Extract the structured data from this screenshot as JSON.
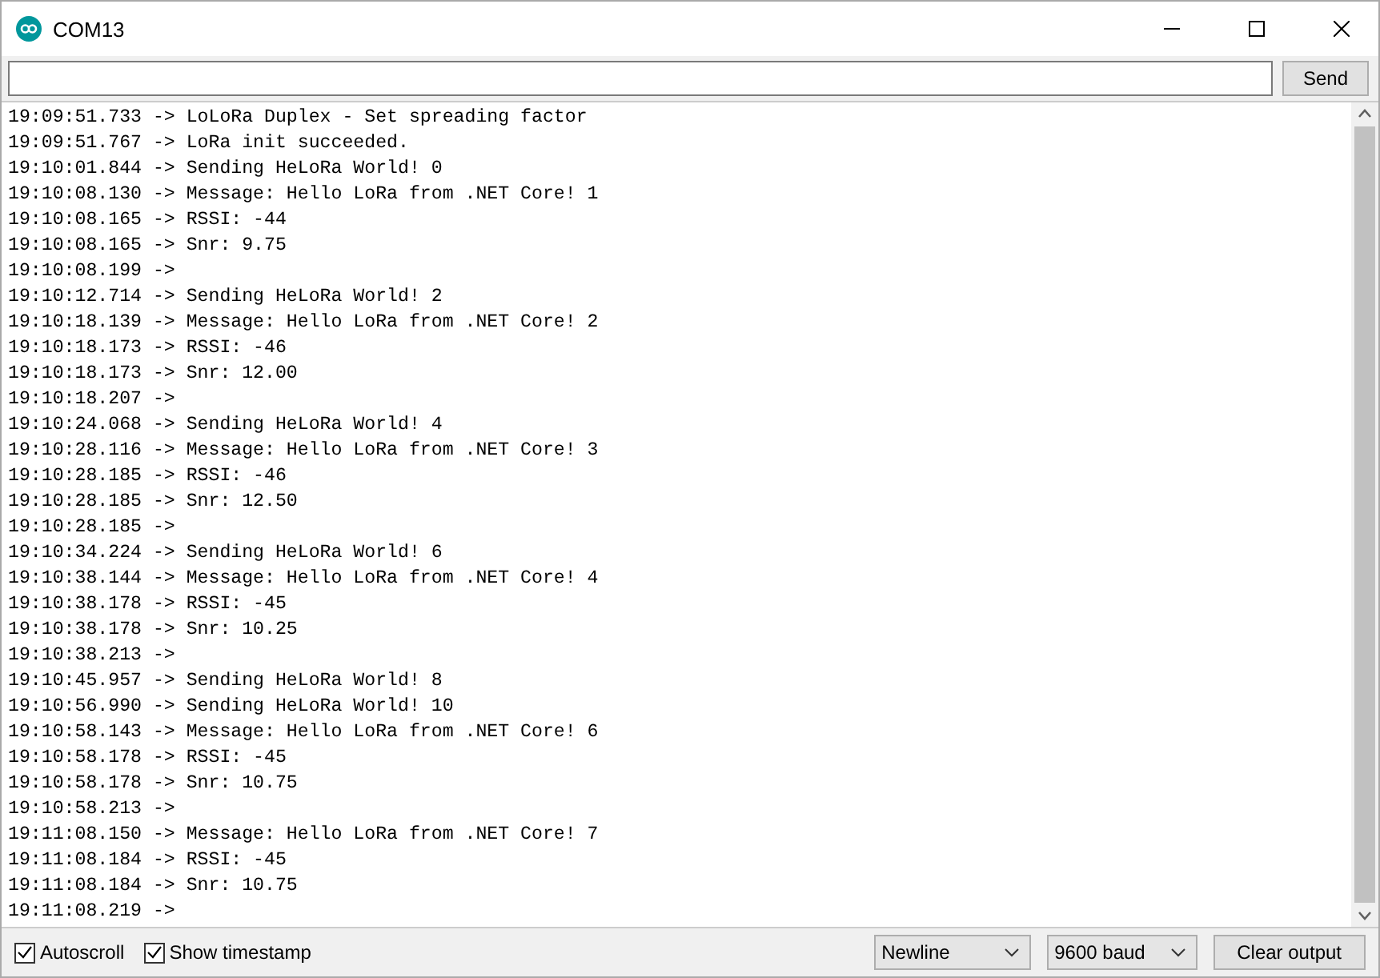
{
  "window": {
    "title": "COM13"
  },
  "send_button": "Send",
  "log": [
    "19:09:51.733 -> LoLoRa Duplex - Set spreading factor",
    "19:09:51.767 -> LoRa init succeeded.",
    "19:10:01.844 -> Sending HeLoRa World! 0",
    "19:10:08.130 -> Message: Hello LoRa from .NET Core! 1",
    "19:10:08.165 -> RSSI: -44",
    "19:10:08.165 -> Snr: 9.75",
    "19:10:08.199 ->",
    "19:10:12.714 -> Sending HeLoRa World! 2",
    "19:10:18.139 -> Message: Hello LoRa from .NET Core! 2",
    "19:10:18.173 -> RSSI: -46",
    "19:10:18.173 -> Snr: 12.00",
    "19:10:18.207 ->",
    "19:10:24.068 -> Sending HeLoRa World! 4",
    "19:10:28.116 -> Message: Hello LoRa from .NET Core! 3",
    "19:10:28.185 -> RSSI: -46",
    "19:10:28.185 -> Snr: 12.50",
    "19:10:28.185 ->",
    "19:10:34.224 -> Sending HeLoRa World! 6",
    "19:10:38.144 -> Message: Hello LoRa from .NET Core! 4",
    "19:10:38.178 -> RSSI: -45",
    "19:10:38.178 -> Snr: 10.25",
    "19:10:38.213 ->",
    "19:10:45.957 -> Sending HeLoRa World! 8",
    "19:10:56.990 -> Sending HeLoRa World! 10",
    "19:10:58.143 -> Message: Hello LoRa from .NET Core! 6",
    "19:10:58.178 -> RSSI: -45",
    "19:10:58.178 -> Snr: 10.75",
    "19:10:58.213 ->",
    "19:11:08.150 -> Message: Hello LoRa from .NET Core! 7",
    "19:11:08.184 -> RSSI: -45",
    "19:11:08.184 -> Snr: 10.75",
    "19:11:08.219 ->"
  ],
  "options": [
    {
      "label": "Autoscroll",
      "checked": true
    },
    {
      "label": "Show timestamp",
      "checked": true
    }
  ],
  "line_ending": "Newline",
  "baud": "9600 baud",
  "clear_button": "Clear output"
}
